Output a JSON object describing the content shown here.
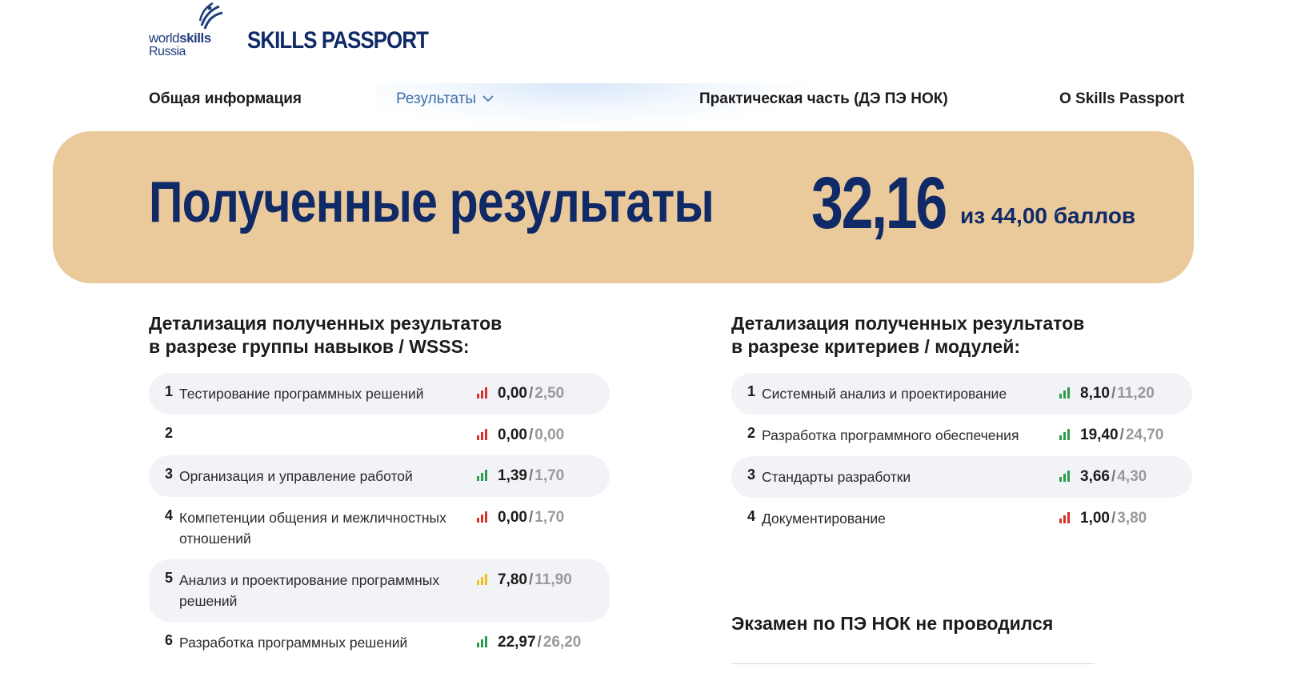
{
  "brand": {
    "logo_word_light": "world",
    "logo_word_bold": "skills",
    "logo_sub": "Russia",
    "site_title": "SKILLS PASSPORT"
  },
  "nav": {
    "general": "Общая информация",
    "results": "Результаты",
    "practical": "Практическая часть (ДЭ ПЭ НОК)",
    "about": "О Skills Passport"
  },
  "banner": {
    "title": "Полученные результаты",
    "score": "32,16",
    "score_of": "из 44,00 баллов"
  },
  "skills": {
    "title": "Детализация полученных результатов\nв разрезе группы навыков / WSSS:",
    "rows": [
      {
        "num": "1",
        "label": "Тестирование программных решений",
        "got": "0,00",
        "max": "2,50",
        "level": "low"
      },
      {
        "num": "2",
        "label": "",
        "got": "0,00",
        "max": "0,00",
        "level": "low"
      },
      {
        "num": "3",
        "label": "Организация и управление работой",
        "got": "1,39",
        "max": "1,70",
        "level": "high"
      },
      {
        "num": "4",
        "label": "Компетенции общения и межличностных отношений",
        "got": "0,00",
        "max": "1,70",
        "level": "low"
      },
      {
        "num": "5",
        "label": "Анализ и проектирование программных решений",
        "got": "7,80",
        "max": "11,90",
        "level": "mid"
      },
      {
        "num": "6",
        "label": "Разработка программных решений",
        "got": "22,97",
        "max": "26,20",
        "level": "high"
      }
    ]
  },
  "criteria": {
    "title": "Детализация полученных результатов\nв разрезе критериев / модулей:",
    "rows": [
      {
        "num": "1",
        "label": "Системный анализ и проектирование",
        "got": "8,10",
        "max": "11,20",
        "level": "high"
      },
      {
        "num": "2",
        "label": "Разработка программного обеспечения",
        "got": "19,40",
        "max": "24,70",
        "level": "high"
      },
      {
        "num": "3",
        "label": "Стандарты разработки",
        "got": "3,66",
        "max": "4,30",
        "level": "high"
      },
      {
        "num": "4",
        "label": "Документирование",
        "got": "1,00",
        "max": "3,80",
        "level": "low"
      }
    ]
  },
  "exam_note": "Экзамен по ПЭ НОК не проводился",
  "colors": {
    "navy": "#0f2a66",
    "banner_bg": "#eac99b",
    "row_shade": "#f2f3f7",
    "bar_low": "#d9302b",
    "bar_mid": "#f0c020",
    "bar_high": "#2e9b4c",
    "bar_off": "#c9c9c9"
  }
}
